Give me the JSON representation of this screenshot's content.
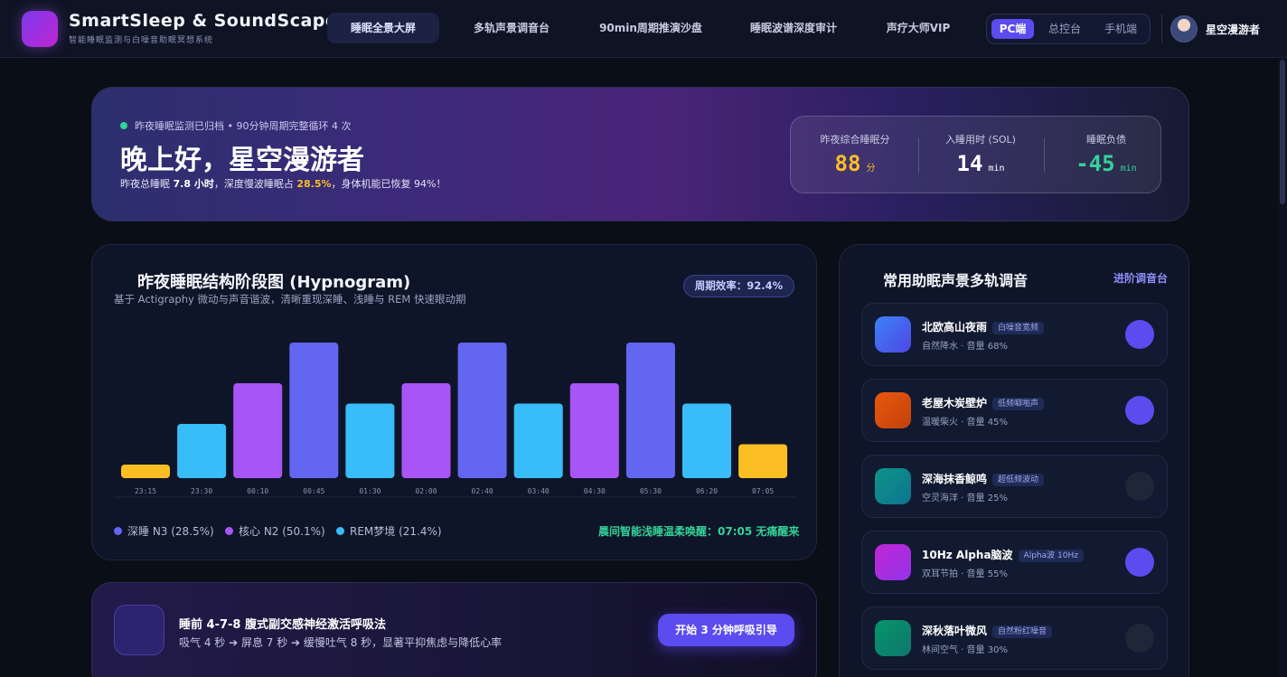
{
  "header": {
    "brand_title": "SmartSleep & SoundScape",
    "brand_subtitle": "智能睡眠监测与白噪音助眠冥想系统",
    "nav": [
      {
        "label": "睡眠全景大屏",
        "active": true
      },
      {
        "label": "多轨声景调音台",
        "active": false
      },
      {
        "label": "90min周期推演沙盘",
        "active": false
      },
      {
        "label": "睡眠波谱深度审计",
        "active": false
      },
      {
        "label": "声疗大师VIP",
        "active": false
      }
    ],
    "platform_switch": {
      "options": [
        "PC端",
        "总控台",
        "手机端"
      ],
      "selected": "PC端"
    },
    "user_name": "星空漫游者"
  },
  "hero": {
    "status": "昨夜睡眠监测已归档 • 90分钟周期完整循环 4 次",
    "greeting": "晚上好，星空漫游者",
    "summary_prefix": "昨夜总睡眠 ",
    "total_sleep": "7.8 小时",
    "summary_mid": "，深度慢波睡眠占 ",
    "deep_ratio": "28.5%",
    "summary_suffix": "，身体机能已恢复 94%！",
    "stats": [
      {
        "label": "昨夜综合睡眠分",
        "value": "88",
        "unit": "分",
        "color": "#fbbf24"
      },
      {
        "label": "入睡用时 (SOL)",
        "value": "14",
        "unit": "min",
        "color": "#ffffff"
      },
      {
        "label": "睡眠负债",
        "value": "-45",
        "unit": "min",
        "color": "#34d399"
      }
    ]
  },
  "hypnogram": {
    "title": "昨夜睡眠结构阶段图 (Hypnogram)",
    "subtitle": "基于 Actigraphy 微动与声音谐波，清晰重现深睡、浅睡与 REM 快速眼动期",
    "efficiency_badge": "周期效率：92.4%",
    "legend": [
      {
        "label": "深睡 N3 (28.5%)",
        "color": "#6366f1"
      },
      {
        "label": "核心 N2 (50.1%)",
        "color": "#a855f7"
      },
      {
        "label": "REM梦境 (21.4%)",
        "color": "#38bdf8"
      }
    ],
    "wake_note": "晨间智能浅睡温柔唤醒：07:05 无痛醒来"
  },
  "chart_data": {
    "type": "bar",
    "categories": [
      "23:15",
      "23:30",
      "00:10",
      "00:45",
      "01:30",
      "02:00",
      "02:40",
      "03:40",
      "04:30",
      "05:30",
      "06:20",
      "07:05"
    ],
    "values": [
      1,
      4,
      7,
      10,
      5.5,
      7,
      10,
      5.5,
      7,
      10,
      5.5,
      2.5
    ],
    "stages": [
      "wake",
      "rem",
      "n2",
      "n3",
      "rem",
      "n2",
      "n3",
      "rem",
      "n2",
      "n3",
      "rem",
      "wake"
    ],
    "colors": {
      "wake": "#fbbf24",
      "rem": "#38bdf8",
      "n2": "#a855f7",
      "n3": "#6366f1"
    },
    "ylim": [
      0,
      10
    ],
    "grid": false
  },
  "breathing": {
    "title": "睡前 4-7-8 腹式副交感神经激活呼吸法",
    "desc": "吸气 4 秒 ➔ 屏息 7 秒 ➔ 缓慢吐气 8 秒，显著平抑焦虑与降低心率",
    "button": "开始 3 分钟呼吸引导"
  },
  "soundscape": {
    "title": "常用助眠声景多轨调音",
    "link": "进阶调音台",
    "tracks": [
      {
        "name": "北欧高山夜雨",
        "tag": "白噪音宽频",
        "meta": "自然降水 · 音量 68%",
        "volume": 68,
        "playing": true,
        "grad": "linear-gradient(135deg,#3b82f6,#4f46e5)"
      },
      {
        "name": "老屋木炭壁炉",
        "tag": "低频噼啪声",
        "meta": "温暖柴火 · 音量 45%",
        "volume": 45,
        "playing": true,
        "grad": "linear-gradient(135deg,#ea580c,#c2410c)"
      },
      {
        "name": "深海抹香鲸鸣",
        "tag": "超低频波动",
        "meta": "空灵海洋 · 音量 25%",
        "volume": 25,
        "playing": false,
        "grad": "linear-gradient(135deg,#0d9488,#0e7490)"
      },
      {
        "name": "10Hz Alpha脑波",
        "tag": "Alpha波 10Hz",
        "meta": "双耳节拍 · 音量 55%",
        "volume": 55,
        "playing": true,
        "grad": "linear-gradient(135deg,#c026d3,#9333ea)"
      },
      {
        "name": "深秋落叶微风",
        "tag": "自然粉红噪音",
        "meta": "林间空气 · 音量 30%",
        "volume": 30,
        "playing": false,
        "grad": "linear-gradient(135deg,#059669,#0f766e)"
      }
    ]
  }
}
